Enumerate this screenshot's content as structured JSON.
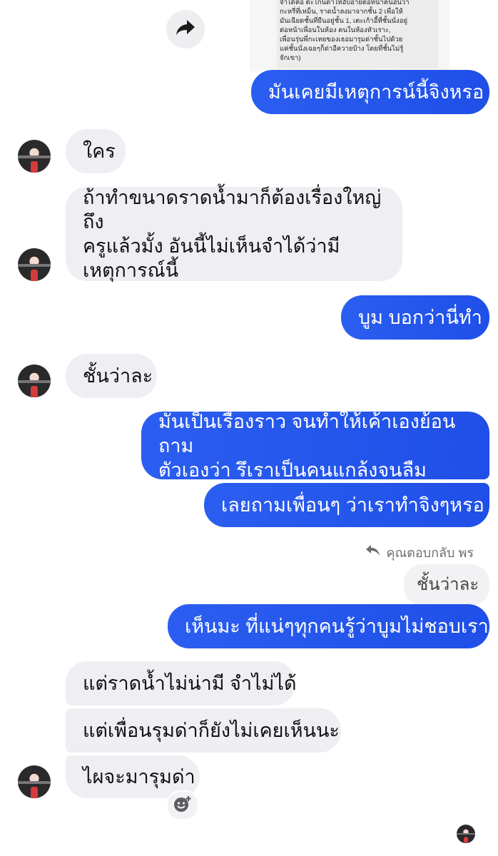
{
  "forwarded_preview": {
    "lines": [
      "จำได้คือ ตะโกนด่าให้อับอายต่อหน้าคนอื่นว่า",
      "กะหรี่ที่เหม็น, ราดน้ำลงมาจากชั้น 2 เพื่อให้",
      "มันเฉียดชั้นที่ยืนอยู่ชั้น 1, เตะเก้าอี้ที่ชั้นนั่งอยู่",
      "ต่อหน้าเพื่อนในห้อง คนในห้องหัวเราะ,",
      "เพื่อนรุ่นพี่กะเทยของเธอมารุมด่าชั้นไปด้วย",
      "แค่ชั้นนั่งเฉยๆก็ด่าอีควายบ้าง โดยที่ชั้นไม่รู้",
      "จักเขา)"
    ]
  },
  "messages": [
    {
      "text": "มันเคยมีเหตุการน์นี้จิงหรอ"
    },
    {
      "text": "ใคร"
    },
    {
      "lines": [
        "ถ้าทำขนาดราดน้ำมาก็ต้องเรื่องใหญ่ถึง",
        "ครูแล้วมั้ง อันนี้ไม่เห็นจำได้ว่ามี",
        "เหตุการณ์นี้"
      ]
    },
    {
      "text": "บูม บอกว่านี่ทำ"
    },
    {
      "text": "ชั้นว่าละ"
    },
    {
      "lines": [
        "มันเป็นเรื่องราว จนทำให้เค้าเองย้อนถาม",
        "ตัวเองว่า รึเราเป็นคนแกล้งจนลืม"
      ]
    },
    {
      "text": "เลยถามเพื่อนๆ ว่าเราทำจิงๆหรอ"
    },
    {
      "text": "เห็นมะ ที่แน่ๆทุกคนรู้ว่าบูมไม่ชอบเรา"
    },
    {
      "text": "แต่ราดน้ำไม่น่ามี จำไม่ได้"
    },
    {
      "text": "แต่เพื่อนรุมด่าก็ยังไม่เคยเห็นนะ"
    },
    {
      "text": "ไผจะมารุมด่า"
    }
  ],
  "reply_context": {
    "label": "คุณตอบกลับ พร",
    "quoted": "ชั้นว่าละ"
  },
  "icons": {
    "forward": "forward-share-icon",
    "reply": "reply-arrow-icon",
    "react": "add-reaction-icon"
  },
  "colors": {
    "outgoing": "#2b5ef0",
    "incoming": "#efeff3",
    "quoted": "#f2f2f4"
  }
}
